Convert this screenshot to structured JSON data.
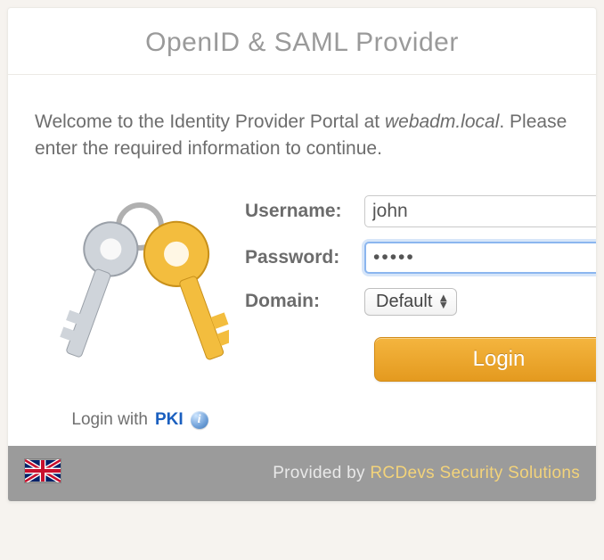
{
  "header": {
    "title": "OpenID & SAML Provider"
  },
  "welcome": {
    "prefix": "Welcome to the Identity Provider Portal at ",
    "host": "webadm.local",
    "suffix": ". Please enter the required information to continue."
  },
  "form": {
    "username_label": "Username:",
    "username_value": "john",
    "password_label": "Password:",
    "password_value": "•••••",
    "domain_label": "Domain:",
    "domain_value": "Default",
    "login_label": "Login"
  },
  "pki": {
    "prefix": "Login with ",
    "link": "PKI"
  },
  "footer": {
    "prefix": "Provided by ",
    "brand": "RCDevs Security Solutions"
  }
}
